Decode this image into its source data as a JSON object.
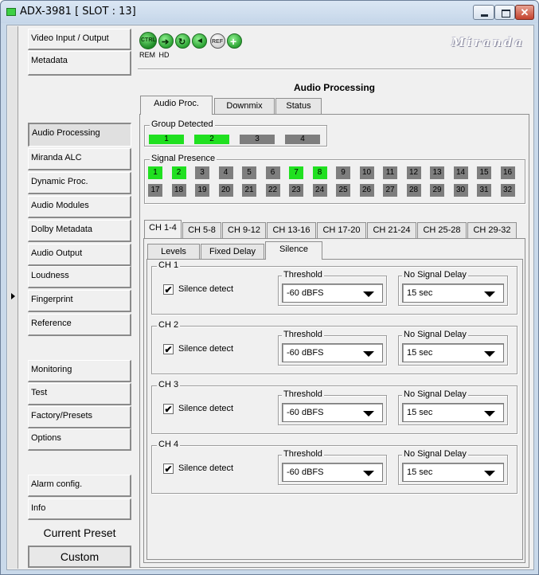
{
  "window": {
    "title": "ADX-3981 [ SLOT : 13]"
  },
  "sidebar": {
    "items": [
      {
        "label": "Video Input / Output"
      },
      {
        "label": "Metadata"
      },
      {
        "label": "Audio Processing"
      },
      {
        "label": "Miranda ALC"
      },
      {
        "label": "Dynamic Proc."
      },
      {
        "label": "Audio Modules"
      },
      {
        "label": "Dolby Metadata"
      },
      {
        "label": "Audio Output"
      },
      {
        "label": "Loudness"
      },
      {
        "label": "Fingerprint"
      },
      {
        "label": "Reference"
      },
      {
        "label": "Monitoring"
      },
      {
        "label": "Test"
      },
      {
        "label": "Factory/Presets"
      },
      {
        "label": "Options"
      },
      {
        "label": "Alarm config."
      },
      {
        "label": "Info"
      }
    ],
    "current_preset_label": "Current Preset",
    "current_preset_value": "Custom"
  },
  "toolbar": {
    "ctrl_label": "CTRL",
    "ref_label": "REF",
    "rem_label": "REM",
    "hd_label": "HD",
    "brand": "Miranda"
  },
  "panel": {
    "title": "Audio Processing",
    "tabs": [
      "Audio Proc.",
      "Downmix",
      "Status"
    ]
  },
  "group_detected": {
    "label": "Group Detected",
    "groups": [
      {
        "label": "1",
        "active": true
      },
      {
        "label": "2",
        "active": true
      },
      {
        "label": "3",
        "active": false
      },
      {
        "label": "4",
        "active": false
      }
    ]
  },
  "signal_presence": {
    "label": "Signal Presence",
    "row1": [
      "1",
      "2",
      "3",
      "4",
      "5",
      "6",
      "7",
      "8",
      "9",
      "10",
      "11",
      "12",
      "13",
      "14",
      "15",
      "16"
    ],
    "row2": [
      "17",
      "18",
      "19",
      "20",
      "21",
      "22",
      "23",
      "24",
      "25",
      "26",
      "27",
      "28",
      "29",
      "30",
      "31",
      "32"
    ],
    "active": [
      "1",
      "2",
      "7",
      "8"
    ]
  },
  "channel_tabs": [
    "CH 1-4",
    "CH 5-8",
    "CH 9-12",
    "CH 13-16",
    "CH 17-20",
    "CH 21-24",
    "CH 25-28",
    "CH 29-32"
  ],
  "sub_tabs": [
    "Levels",
    "Fixed Delay",
    "Silence"
  ],
  "channels": [
    {
      "label": "CH 1",
      "checkbox_label": "Silence detect",
      "checked": true,
      "threshold_label": "Threshold",
      "threshold": "-60 dBFS",
      "delay_label": "No Signal Delay",
      "delay": "15 sec"
    },
    {
      "label": "CH 2",
      "checkbox_label": "Silence detect",
      "checked": true,
      "threshold_label": "Threshold",
      "threshold": "-60 dBFS",
      "delay_label": "No Signal Delay",
      "delay": "15 sec"
    },
    {
      "label": "CH 3",
      "checkbox_label": "Silence detect",
      "checked": true,
      "threshold_label": "Threshold",
      "threshold": "-60 dBFS",
      "delay_label": "No Signal Delay",
      "delay": "15 sec"
    },
    {
      "label": "CH 4",
      "checkbox_label": "Silence detect",
      "checked": true,
      "threshold_label": "Threshold",
      "threshold": "-60 dBFS",
      "delay_label": "No Signal Delay",
      "delay": "15 sec"
    }
  ],
  "colors": {
    "active_green": "#20e020",
    "inactive_gray": "#7e7e7e"
  }
}
